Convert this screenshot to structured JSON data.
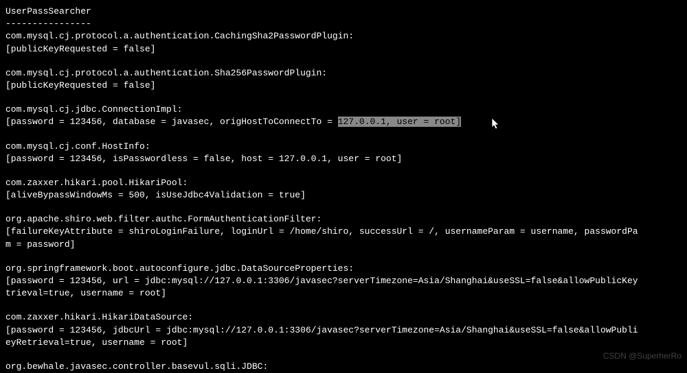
{
  "header": {
    "title": "UserPassSearcher",
    "divider": "----------------"
  },
  "blocks": [
    {
      "class": "com.mysql.cj.protocol.a.authentication.CachingSha2PasswordPlugin:",
      "props": "[publicKeyRequested = false]"
    },
    {
      "class": "com.mysql.cj.protocol.a.authentication.Sha256PasswordPlugin:",
      "props": "[publicKeyRequested = false]"
    },
    {
      "class": "com.mysql.cj.jdbc.ConnectionImpl:",
      "props_pre": "[password = 123456, database = javasec, origHostToConnectTo = ",
      "props_sel": "127.0.0.1, user = root]",
      "has_selection": true
    },
    {
      "class": "com.mysql.cj.conf.HostInfo:",
      "props": "[password = 123456, isPasswordless = false, host = 127.0.0.1, user = root]"
    },
    {
      "class": "com.zaxxer.hikari.pool.HikariPool:",
      "props": "[aliveBypassWindowMs = 500, isUseJdbc4Validation = true]"
    },
    {
      "class": "org.apache.shiro.web.filter.authc.FormAuthenticationFilter:",
      "props": "[failureKeyAttribute = shiroLoginFailure, loginUrl = /home/shiro, successUrl = /, usernameParam = username, passwordPa",
      "props2": "m = password]"
    },
    {
      "class": "org.springframework.boot.autoconfigure.jdbc.DataSourceProperties:",
      "props": "[password = 123456, url = jdbc:mysql://127.0.0.1:3306/javasec?serverTimezone=Asia/Shanghai&useSSL=false&allowPublicKey",
      "props2": "trieval=true, username = root]"
    },
    {
      "class": "com.zaxxer.hikari.HikariDataSource:",
      "props": "[password = 123456, jdbcUrl = jdbc:mysql://127.0.0.1:3306/javasec?serverTimezone=Asia/Shanghai&useSSL=false&allowPubli",
      "props2": "eyRetrieval=true, username = root]"
    },
    {
      "class": "org.bewhale.javasec.controller.basevul.sqli.JDBC:",
      "no_props": true
    }
  ],
  "watermark": "CSDN @SuperherRo"
}
